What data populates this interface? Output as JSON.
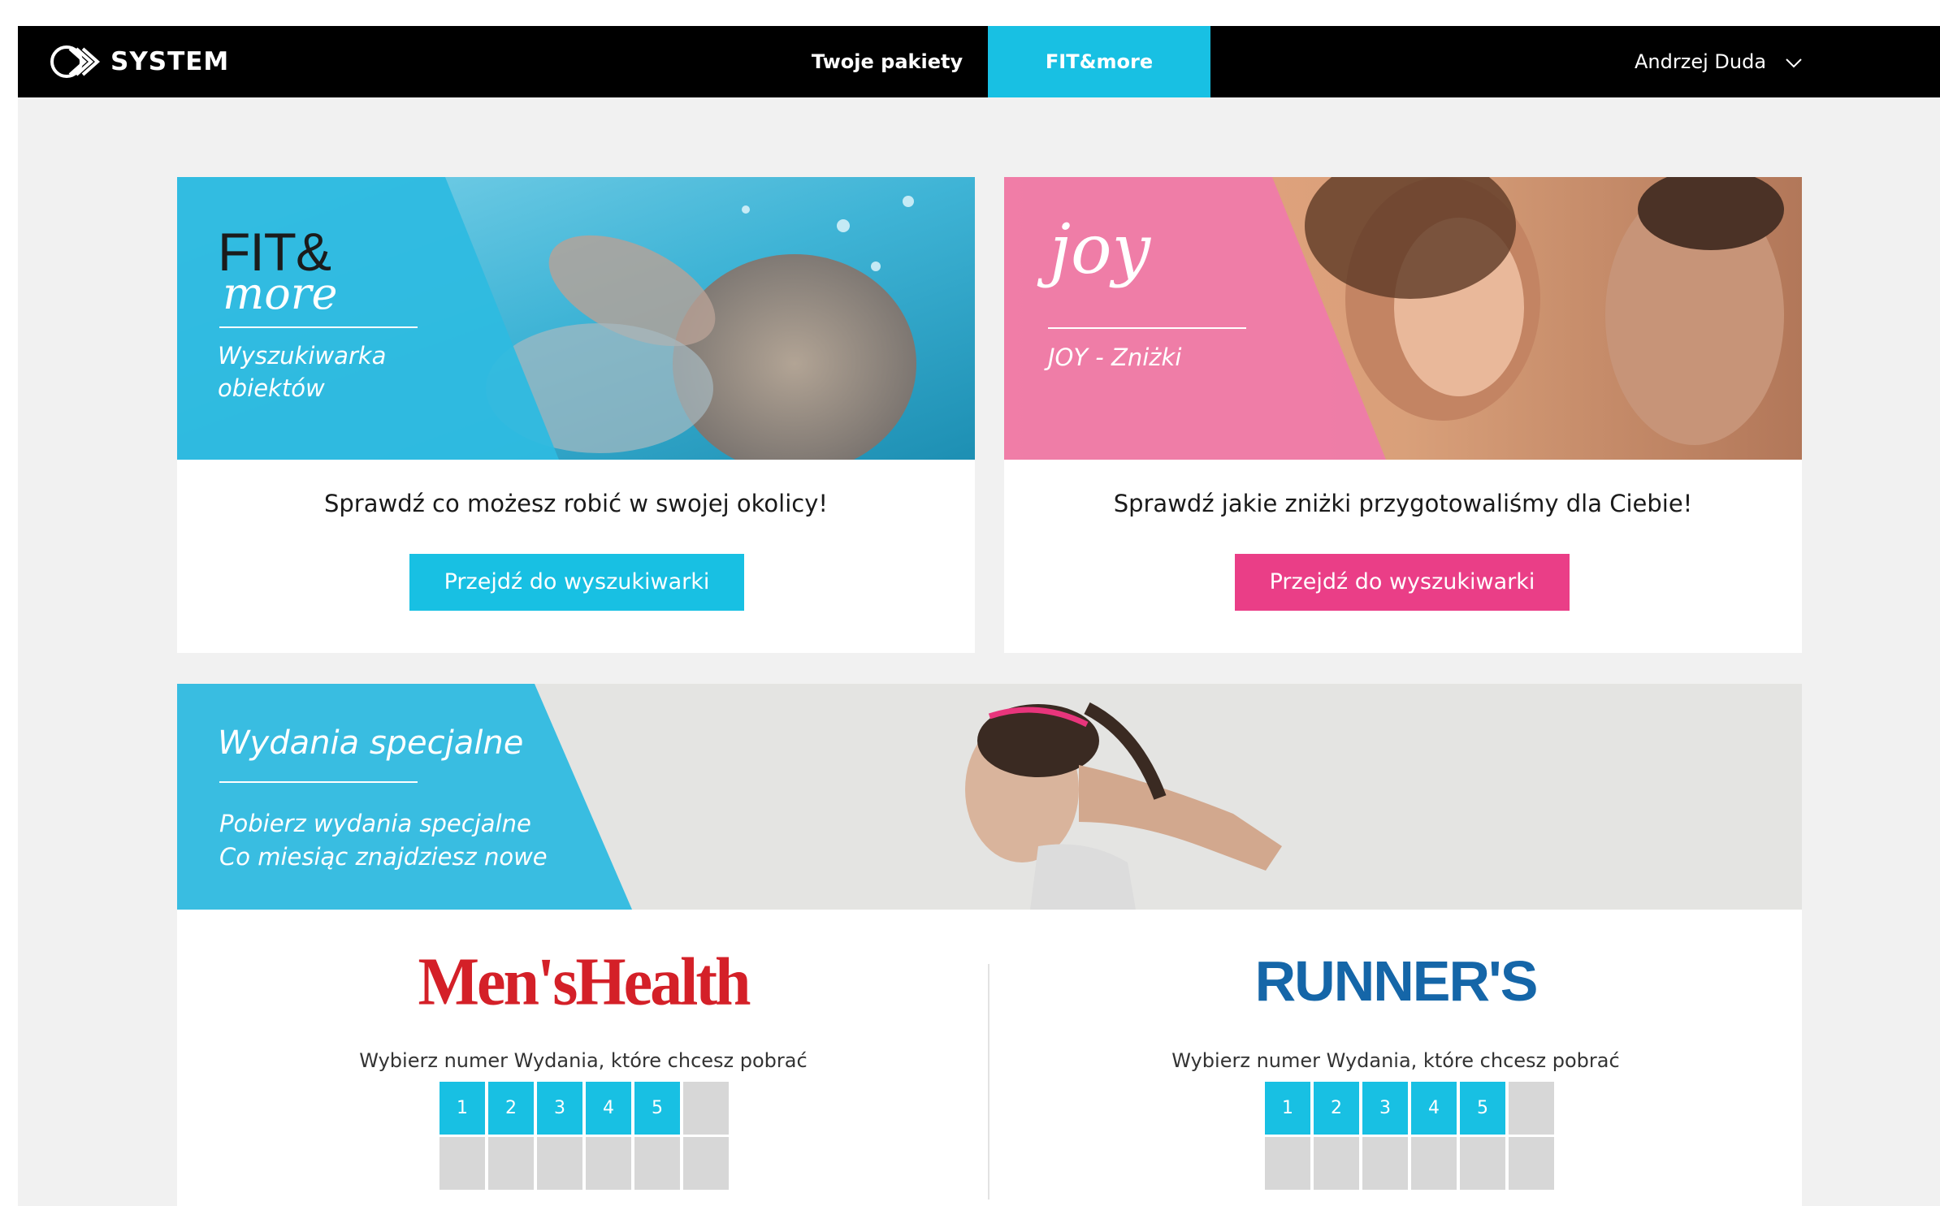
{
  "header": {
    "logo_text": "SYSTEM",
    "nav": [
      {
        "label": "Twoje pakiety",
        "active": false
      },
      {
        "label": "FIT&more",
        "active": true
      }
    ],
    "user_name": "Andrzej Duda",
    "accent_color": "#18c0e3"
  },
  "fit_card": {
    "brand_line1": "FIT&",
    "brand_line2": "more",
    "subtitle_line1": "Wyszukiwarka",
    "subtitle_line2": "obiektów",
    "text": "Sprawdź co możesz robić w swojej okolicy!",
    "button_label": "Przejdź do wyszukiwarki",
    "color": "#18c0e3"
  },
  "joy_card": {
    "brand": "joy",
    "subtitle": "JOY - Zniżki",
    "text": "Sprawdź jakie zniżki przygotowaliśmy dla Ciebie!",
    "button_label": "Przejdź do wyszukiwarki",
    "color": "#ea3e87"
  },
  "special": {
    "title": "Wydania specjalne",
    "subtitle_line1": "Pobierz wydania specjalne",
    "subtitle_line2": "Co miesiąc znajdziesz nowe",
    "magazines": [
      {
        "name": "Men'sHealth",
        "prompt": "Wybierz numer Wydania, które chcesz pobrać",
        "issues": [
          "1",
          "2",
          "3",
          "4",
          "5"
        ]
      },
      {
        "name": "RUNNER'S",
        "prompt": "Wybierz numer Wydania, które chcesz pobrać",
        "issues": [
          "1",
          "2",
          "3",
          "4",
          "5"
        ]
      }
    ]
  }
}
